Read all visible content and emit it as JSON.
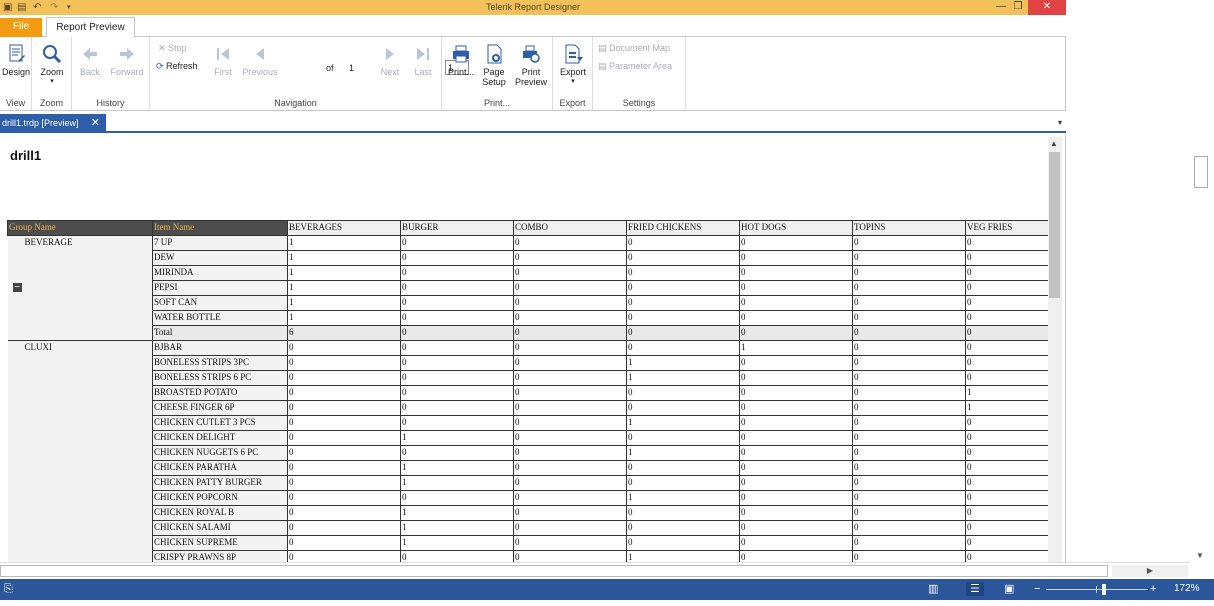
{
  "window": {
    "title": "Telerik Report Designer",
    "close_glyph": "✕",
    "minimize_glyph": "—",
    "restore_glyph": "❐"
  },
  "ribbon_tabs": {
    "file": "File",
    "report_preview": "Report Preview"
  },
  "ribbon": {
    "view": {
      "group": "View",
      "design": "Design"
    },
    "zoom": {
      "group": "Zoom",
      "zoom": "Zoom"
    },
    "history": {
      "group": "History",
      "back": "Back",
      "forward": "Forward"
    },
    "navigation": {
      "group": "Navigation",
      "stop": "Stop",
      "refresh": "Refresh",
      "first": "First",
      "previous": "Previous",
      "page_value": "1",
      "of": "of",
      "total_pages": "1",
      "next": "Next",
      "last": "Last"
    },
    "print": {
      "group": "Print...",
      "print": "Print...",
      "page_setup_1": "Page",
      "page_setup_2": "Setup",
      "print_preview_1": "Print",
      "print_preview_2": "Preview"
    },
    "export": {
      "group": "Export",
      "export": "Export"
    },
    "settings": {
      "group": "Settings",
      "document_map": "Document Map",
      "parameter_area": "Parameter Area"
    }
  },
  "document_tab": {
    "label": "drill1.trdp [Preview]",
    "close": "✕",
    "overflow": "▾"
  },
  "report": {
    "title": "drill1",
    "headers": {
      "group": "Group Name",
      "item": "Item Name",
      "columns": [
        "BEVERAGES",
        "BURGER",
        "COMBO",
        "FRIED CHICKENS",
        "HOT DOGS",
        "TOPINS",
        "VEG FRIES"
      ]
    },
    "groups": [
      {
        "name": "BEVERAGE",
        "toggle": "−",
        "rows": [
          {
            "item": "7 UP",
            "values": [
              "1",
              "0",
              "0",
              "0",
              "0",
              "0",
              "0"
            ]
          },
          {
            "item": "DEW",
            "values": [
              "1",
              "0",
              "0",
              "0",
              "0",
              "0",
              "0"
            ]
          },
          {
            "item": "MIRINDA",
            "values": [
              "1",
              "0",
              "0",
              "0",
              "0",
              "0",
              "0"
            ]
          },
          {
            "item": "PEPSI",
            "values": [
              "1",
              "0",
              "0",
              "0",
              "0",
              "0",
              "0"
            ]
          },
          {
            "item": "SOFT CAN",
            "values": [
              "1",
              "0",
              "0",
              "0",
              "0",
              "0",
              "0"
            ]
          },
          {
            "item": "WATER BOTTLE",
            "values": [
              "1",
              "0",
              "0",
              "0",
              "0",
              "0",
              "0"
            ]
          },
          {
            "item": "Total",
            "values": [
              "6",
              "0",
              "0",
              "0",
              "0",
              "0",
              "0"
            ],
            "total": true
          }
        ]
      },
      {
        "name": "CLUXI",
        "rows": [
          {
            "item": "BJBAR",
            "values": [
              "0",
              "0",
              "0",
              "0",
              "1",
              "0",
              "0"
            ]
          },
          {
            "item": "BONELESS STRIPS 3PC",
            "values": [
              "0",
              "0",
              "0",
              "1",
              "0",
              "0",
              "0"
            ]
          },
          {
            "item": "BONELESS STRIPS 6 PC",
            "values": [
              "0",
              "0",
              "0",
              "1",
              "0",
              "0",
              "0"
            ]
          },
          {
            "item": "BROASTED POTATO",
            "values": [
              "0",
              "0",
              "0",
              "0",
              "0",
              "0",
              "1"
            ]
          },
          {
            "item": "CHEESE FINGER 6P",
            "values": [
              "0",
              "0",
              "0",
              "0",
              "0",
              "0",
              "1"
            ]
          },
          {
            "item": "CHICKEN CUTLET 3 PCS",
            "values": [
              "0",
              "0",
              "0",
              "1",
              "0",
              "0",
              "0"
            ]
          },
          {
            "item": "CHICKEN DELIGHT",
            "values": [
              "0",
              "1",
              "0",
              "0",
              "0",
              "0",
              "0"
            ]
          },
          {
            "item": "CHICKEN NUGGETS 6 PC",
            "values": [
              "0",
              "0",
              "0",
              "1",
              "0",
              "0",
              "0"
            ]
          },
          {
            "item": "CHICKEN PARATHA",
            "values": [
              "0",
              "1",
              "0",
              "0",
              "0",
              "0",
              "0"
            ]
          },
          {
            "item": "CHICKEN PATTY BURGER",
            "values": [
              "0",
              "1",
              "0",
              "0",
              "0",
              "0",
              "0"
            ]
          },
          {
            "item": "CHICKEN POPCORN",
            "values": [
              "0",
              "0",
              "0",
              "1",
              "0",
              "0",
              "0"
            ]
          },
          {
            "item": "CHICKEN ROYAL B",
            "values": [
              "0",
              "1",
              "0",
              "0",
              "0",
              "0",
              "0"
            ]
          },
          {
            "item": "CHICKEN SALAMI",
            "values": [
              "0",
              "1",
              "0",
              "0",
              "0",
              "0",
              "0"
            ]
          },
          {
            "item": "CHICKEN SUPREME",
            "values": [
              "0",
              "1",
              "0",
              "0",
              "0",
              "0",
              "0"
            ]
          },
          {
            "item": "CRISPY PRAWNS 8P",
            "values": [
              "0",
              "0",
              "0",
              "1",
              "0",
              "0",
              "0"
            ]
          }
        ]
      }
    ]
  },
  "statusbar": {
    "zoom_level": "172%",
    "zoom_minus": "−",
    "zoom_plus": "+"
  },
  "colors": {
    "titlebar": "#f3c15a",
    "file_tab": "#f39c12",
    "accent_blue": "#2b579a",
    "header_dark": "#4d4d4d",
    "header_gold": "#e9b64f"
  }
}
